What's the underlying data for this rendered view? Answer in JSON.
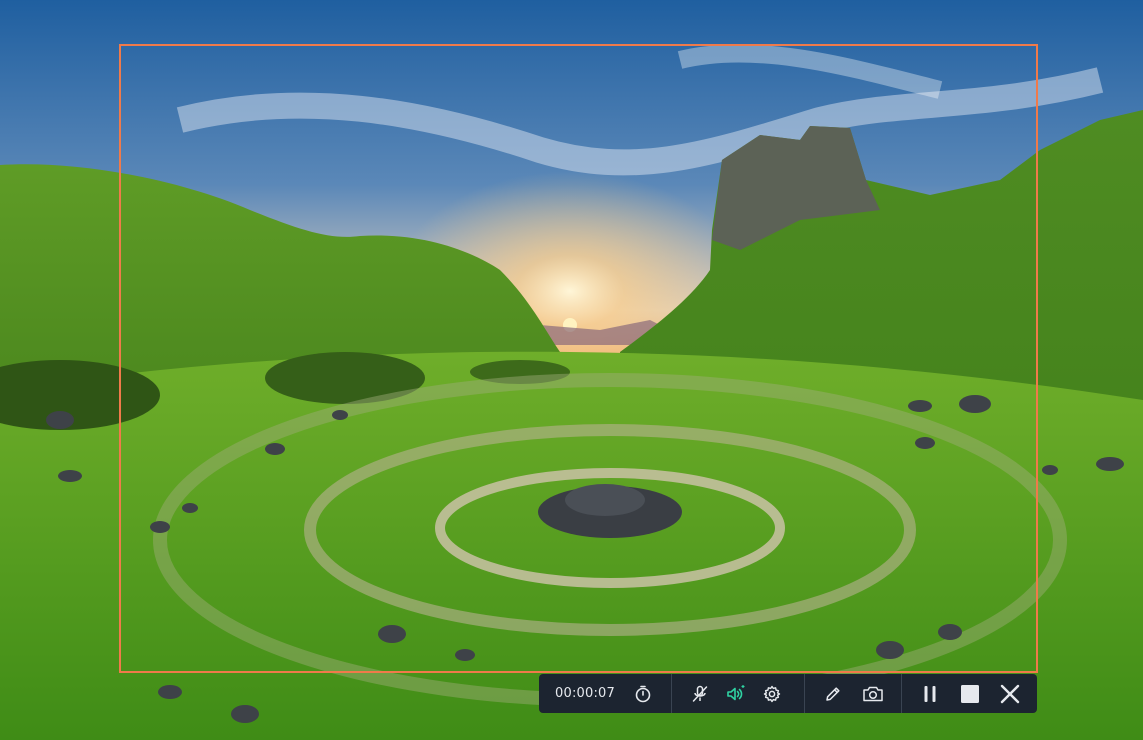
{
  "recording": {
    "elapsed_time": "00:00:07"
  },
  "colors": {
    "frame_border": "#f07a4a",
    "toolbar_bg": "#1c2430",
    "active_icon": "#2fd3a3",
    "icon": "#e6e9ee"
  },
  "toolbar": {
    "icons": [
      "timer-icon",
      "microphone-muted-icon",
      "speaker-icon",
      "settings-icon",
      "pen-icon",
      "camera-icon",
      "pause-icon",
      "stop-icon",
      "close-icon"
    ]
  }
}
